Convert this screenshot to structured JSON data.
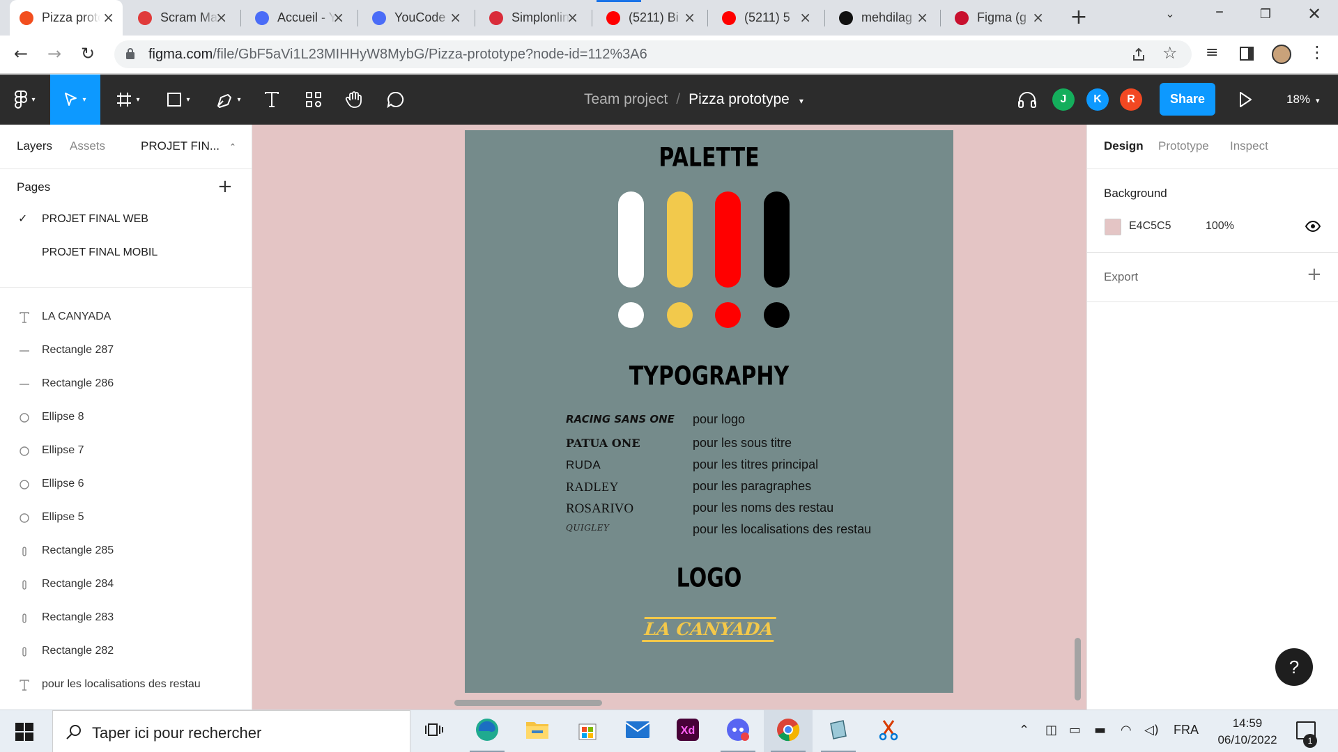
{
  "browser": {
    "tabs": [
      {
        "title": "Pizza prototype – Figma",
        "favicon": "figma-icon",
        "color": "#f24e1e",
        "active": true
      },
      {
        "title": "Scram Master",
        "favicon": "scrum-icon",
        "color": "#e03a3a"
      },
      {
        "title": "Accueil - YouCode",
        "favicon": "youcode-icon",
        "color": "#4a6cf7"
      },
      {
        "title": "YouCode",
        "favicon": "youcode-icon",
        "color": "#4a6cf7"
      },
      {
        "title": "Simplonline",
        "favicon": "simplon-icon",
        "color": "#d92c3a"
      },
      {
        "title": "(5211) Bi",
        "favicon": "youtube-icon",
        "color": "#ff0000"
      },
      {
        "title": "(5211) 5",
        "favicon": "youtube-icon",
        "color": "#ff0000"
      },
      {
        "title": "mehdilag",
        "favicon": "github-icon",
        "color": "#111111"
      },
      {
        "title": "Figma (g",
        "favicon": "figma-j-icon",
        "color": "#c8102e"
      }
    ],
    "url_host": "figma.com",
    "url_path": "/file/GbF5aVi1L23MIHHyW8MybG/Pizza-prototype?node-id=112%3A6"
  },
  "figma": {
    "breadcrumb_team": "Team project",
    "breadcrumb_slash": "/",
    "breadcrumb_file": "Pizza prototype",
    "avatars": [
      {
        "letter": "J",
        "color": "#14ae5c"
      },
      {
        "letter": "K",
        "color": "#0d99ff"
      },
      {
        "letter": "R",
        "color": "#f24822"
      }
    ],
    "share_label": "Share",
    "zoom": "18%"
  },
  "left_panel": {
    "tab_layers": "Layers",
    "tab_assets": "Assets",
    "current_page_short": "PROJET FIN...",
    "pages_title": "Pages",
    "pages": [
      {
        "name": "PROJET FINAL WEB",
        "checked": true
      },
      {
        "name": "PROJET FINAL MOBIL",
        "checked": false
      }
    ],
    "layers": [
      {
        "name": "LA CANYADA",
        "icon": "text-layer-icon"
      },
      {
        "name": "Rectangle 287",
        "icon": "line-layer-icon"
      },
      {
        "name": "Rectangle 286",
        "icon": "line-layer-icon"
      },
      {
        "name": "Ellipse 8",
        "icon": "ellipse-layer-icon"
      },
      {
        "name": "Ellipse 7",
        "icon": "ellipse-layer-icon"
      },
      {
        "name": "Ellipse 6",
        "icon": "ellipse-layer-icon"
      },
      {
        "name": "Ellipse 5",
        "icon": "ellipse-layer-icon"
      },
      {
        "name": "Rectangle 285",
        "icon": "rect-layer-icon"
      },
      {
        "name": "Rectangle 284",
        "icon": "rect-layer-icon"
      },
      {
        "name": "Rectangle 283",
        "icon": "rect-layer-icon"
      },
      {
        "name": "Rectangle 282",
        "icon": "rect-layer-icon"
      },
      {
        "name": "pour les localisations des restau",
        "icon": "text-layer-icon"
      },
      {
        "name": "pour les noms des restau",
        "icon": "text-layer-icon"
      }
    ]
  },
  "canvas": {
    "background": "#e4c5c5",
    "frame_color": "#758b8b",
    "palette_title": "PALETTE",
    "palette_colors": [
      "#ffffff",
      "#f2c94c",
      "#ff0000",
      "#000000"
    ],
    "typography_title": "TYPOGRAPHY",
    "typography": [
      {
        "font": "RACING SANS ONE",
        "use": "pour logo"
      },
      {
        "font": "PATUA ONE",
        "use": "pour les sous titre"
      },
      {
        "font": "RUDA",
        "use": "pour les titres principal"
      },
      {
        "font": "RADLEY",
        "use": "pour les paragraphes"
      },
      {
        "font": "ROSARIVO",
        "use": "pour les noms des restau"
      },
      {
        "font": "QUIGLEY",
        "use": "pour les localisations des restau"
      }
    ],
    "logo_title": "LOGO",
    "logo_text": "LA CANYADA",
    "logo_color": "#f3c84a"
  },
  "right_panel": {
    "tab_design": "Design",
    "tab_prototype": "Prototype",
    "tab_inspect": "Inspect",
    "background_label": "Background",
    "background_hex": "E4C5C5",
    "background_opacity": "100%",
    "export_label": "Export"
  },
  "taskbar": {
    "search_placeholder": "Taper ici pour rechercher",
    "language": "FRA",
    "time": "14:59",
    "date": "06/10/2022",
    "notification_count": "1",
    "apps": [
      "task-view-icon",
      "edge-icon",
      "file-explorer-icon",
      "store-icon",
      "mail-icon",
      "xd-icon",
      "discord-icon",
      "chrome-icon",
      "app-icon",
      "snip-icon"
    ]
  },
  "help_label": "?"
}
